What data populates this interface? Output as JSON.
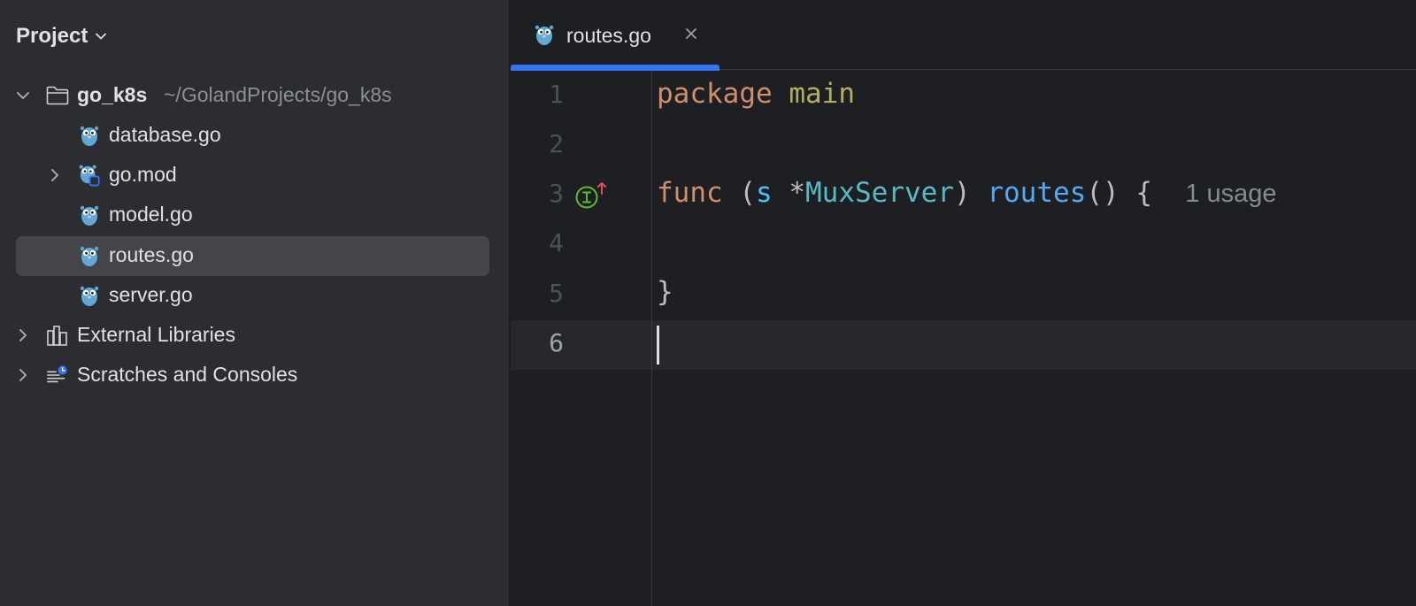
{
  "project_panel": {
    "title": "Project",
    "tree": [
      {
        "label": "go_k8s",
        "path": "~/GolandProjects/go_k8s"
      },
      {
        "label": "database.go"
      },
      {
        "label": "go.mod"
      },
      {
        "label": "model.go"
      },
      {
        "label": "routes.go"
      },
      {
        "label": "server.go"
      },
      {
        "label": "External Libraries"
      },
      {
        "label": "Scratches and Consoles"
      }
    ]
  },
  "editor": {
    "tab": {
      "label": "routes.go"
    },
    "line_numbers": [
      "1",
      "2",
      "3",
      "4",
      "5",
      "6"
    ],
    "code": {
      "line1": {
        "kw": "package",
        "name": "main"
      },
      "line3": {
        "kw": "func",
        "open_paren": "(",
        "receiver": "s",
        "star": "*",
        "type": "MuxServer",
        "close_paren": ")",
        "name": "routes",
        "parens": "()",
        "brace": "{",
        "hint": "1 usage"
      },
      "line5": {
        "brace": "}"
      }
    }
  },
  "colors": {
    "panel_bg": "#2b2d30",
    "editor_bg": "#1e1f22",
    "selection_bg": "#43454a",
    "accent": "#3574f0",
    "keyword": "#cf8e6d",
    "package_name": "#b3ae60",
    "function": "#56a8f5",
    "type": "#5bb8c5",
    "gopher": "#5fa8d8"
  },
  "icons": {
    "go_file": "gopher-icon",
    "folder": "folder-icon",
    "libraries": "libraries-icon",
    "scratches": "scratches-icon",
    "gutter_marker": "implemented-interface-icon"
  }
}
